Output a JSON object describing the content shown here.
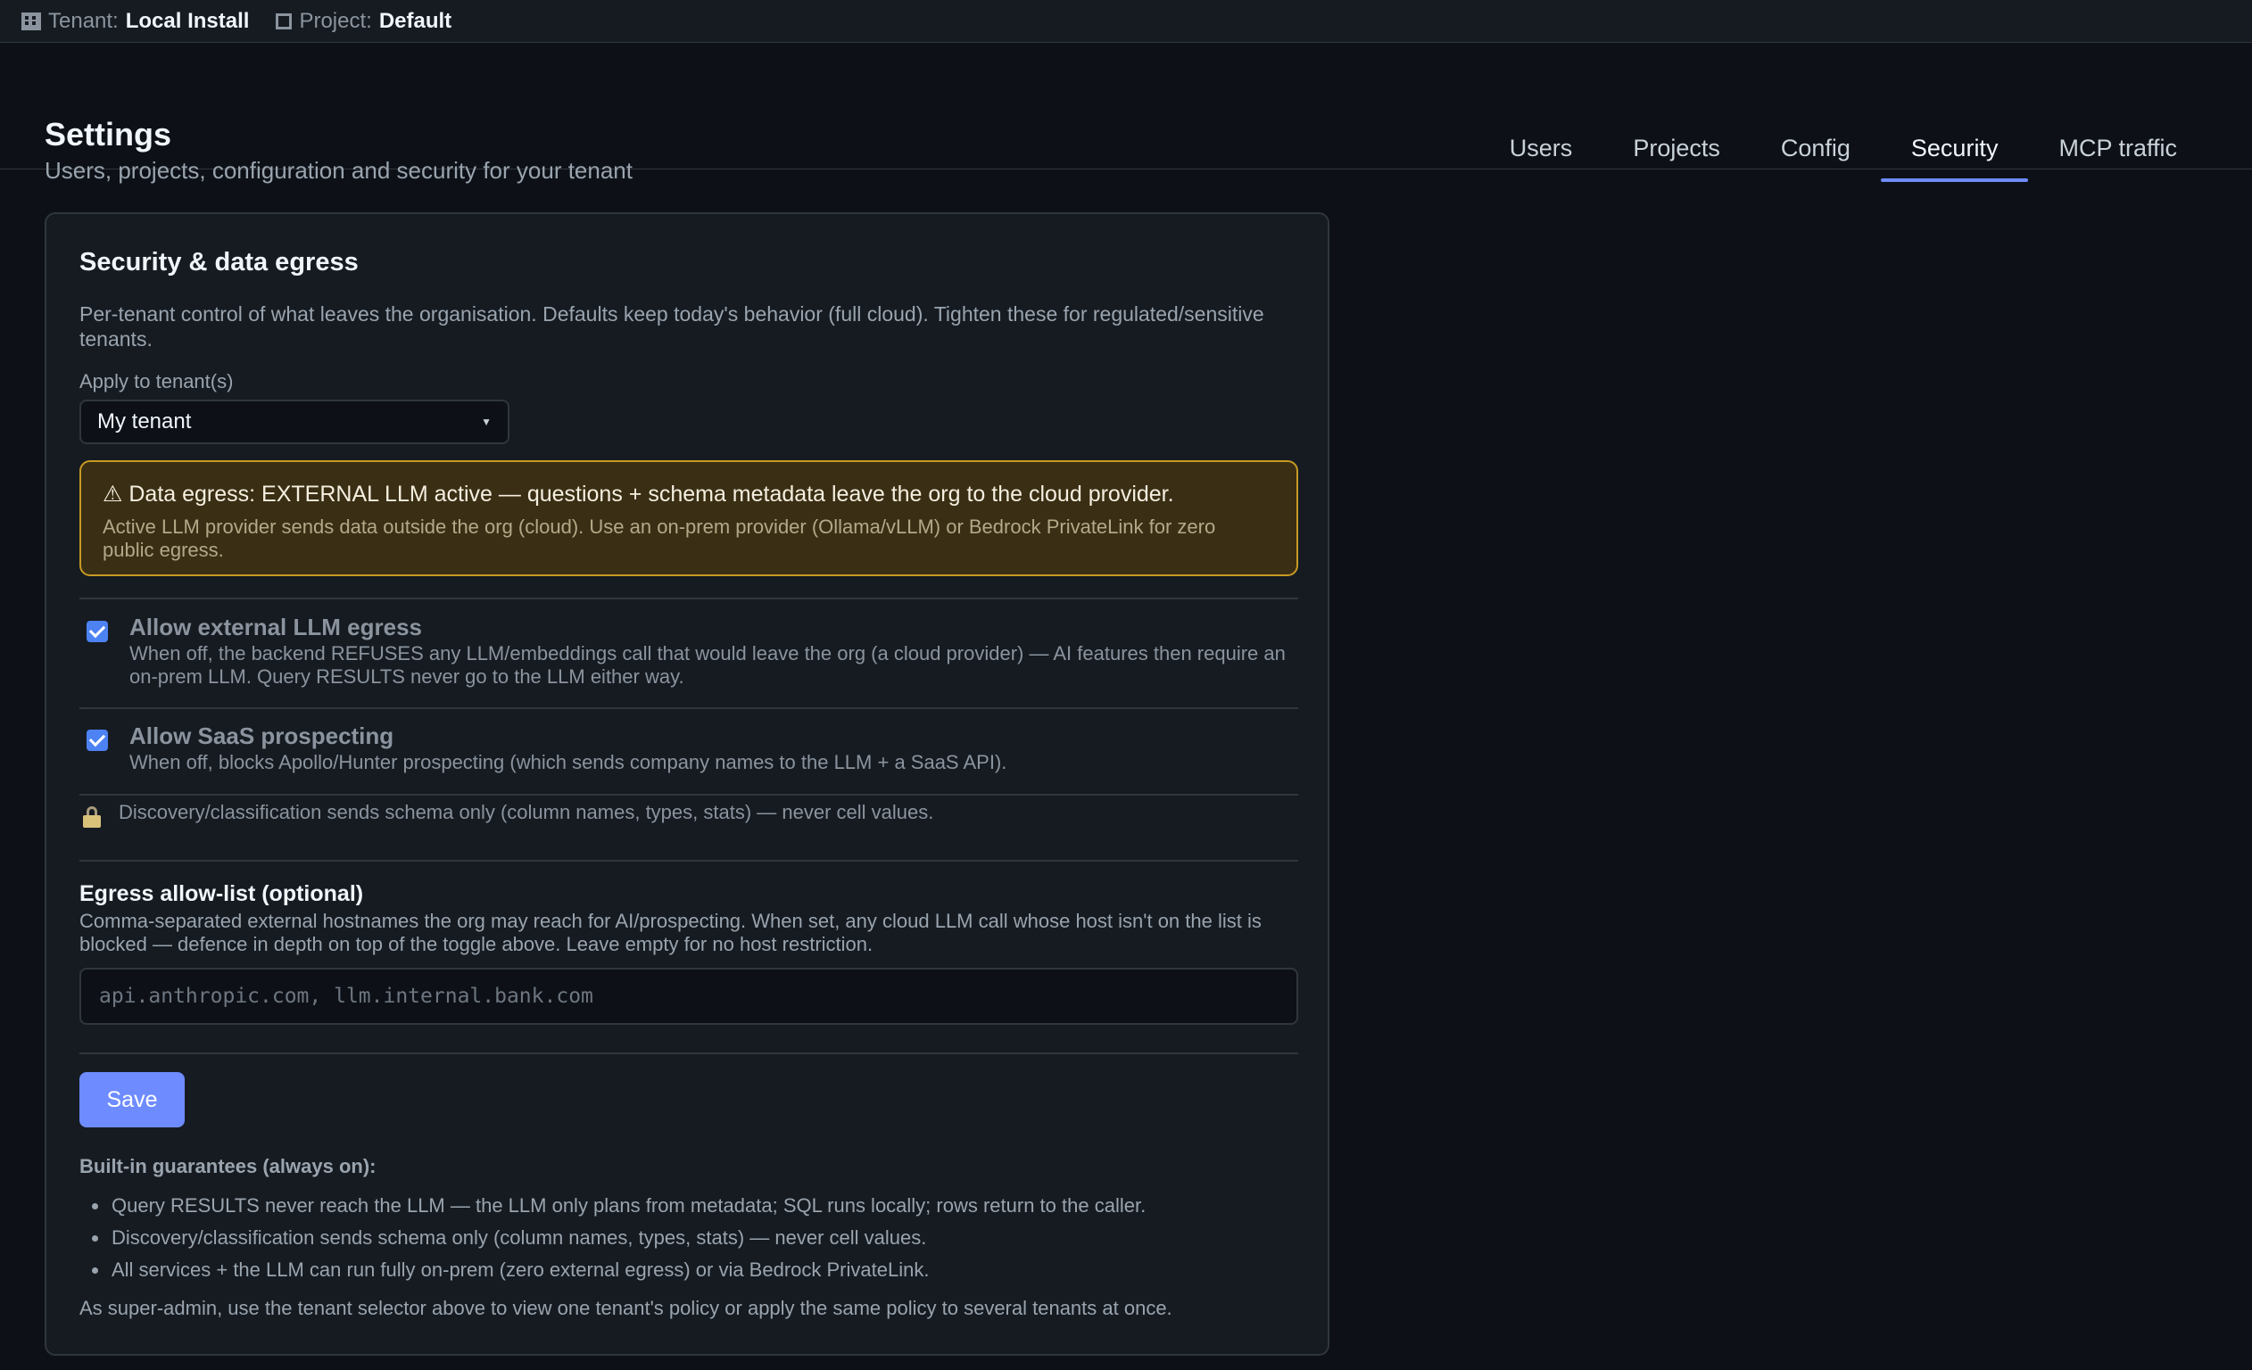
{
  "topbar": {
    "tenant_label": "Tenant:",
    "tenant_value": "Local Install",
    "project_label": "Project:",
    "project_value": "Default"
  },
  "header": {
    "title": "Settings",
    "subtitle": "Users, projects, configuration and security for your tenant"
  },
  "tabs": [
    {
      "label": "Users",
      "active": false
    },
    {
      "label": "Projects",
      "active": false
    },
    {
      "label": "Config",
      "active": false
    },
    {
      "label": "Security",
      "active": true
    },
    {
      "label": "MCP traffic",
      "active": false
    }
  ],
  "card": {
    "title": "Security & data egress",
    "description": "Per-tenant control of what leaves the organisation. Defaults keep today's behavior (full cloud). Tighten these for regulated/sensitive tenants.",
    "tenant_select_label": "Apply to tenant(s)",
    "tenant_select_value": "My tenant",
    "alert": {
      "title": "⚠ Data egress: EXTERNAL LLM active — questions + schema metadata leave the org to the cloud provider.",
      "text": "Active LLM provider sends data outside the org (cloud). Use an on-prem provider (Ollama/vLLM) or Bedrock PrivateLink for zero public egress."
    },
    "options": [
      {
        "title": "Allow external LLM egress",
        "text": "When off, the backend REFUSES any LLM/embeddings call that would leave the org (a cloud provider) — AI features then require an on-prem LLM. Query RESULTS never go to the LLM either way.",
        "checked": true
      },
      {
        "title": "Allow SaaS prospecting",
        "text": "When off, blocks Apollo/Hunter prospecting (which sends company names to the LLM + a SaaS API).",
        "checked": true
      }
    ],
    "lock_note": "Discovery/classification sends schema only (column names, types, stats) — never cell values.",
    "allowlist": {
      "title": "Egress allow-list (optional)",
      "description": "Comma-separated external hostnames the org may reach for AI/prospecting. When set, any cloud LLM call whose host isn't on the list is blocked — defence in depth on top of the toggle above. Leave empty for no host restriction.",
      "placeholder": "api.anthropic.com, llm.internal.bank.com",
      "value": ""
    },
    "save_label": "Save",
    "guarantees_title": "Built-in guarantees (always on):",
    "guarantees": [
      "Query RESULTS never reach the LLM — the LLM only plans from metadata; SQL runs locally; rows return to the caller.",
      "Discovery/classification sends schema only (column names, types, stats) — never cell values.",
      "All services + the LLM can run fully on-prem (zero external egress) or via Bedrock PrivateLink."
    ],
    "footer_note": "As super-admin, use the tenant selector above to view one tenant's policy or apply the same policy to several tenants at once."
  },
  "colors": {
    "accent": "#6e8cff",
    "checkbox": "#4d82f3",
    "alert_border": "#c79a22",
    "alert_bg": "#3a2f14",
    "background": "#0d1117",
    "card_bg": "#161b22"
  }
}
